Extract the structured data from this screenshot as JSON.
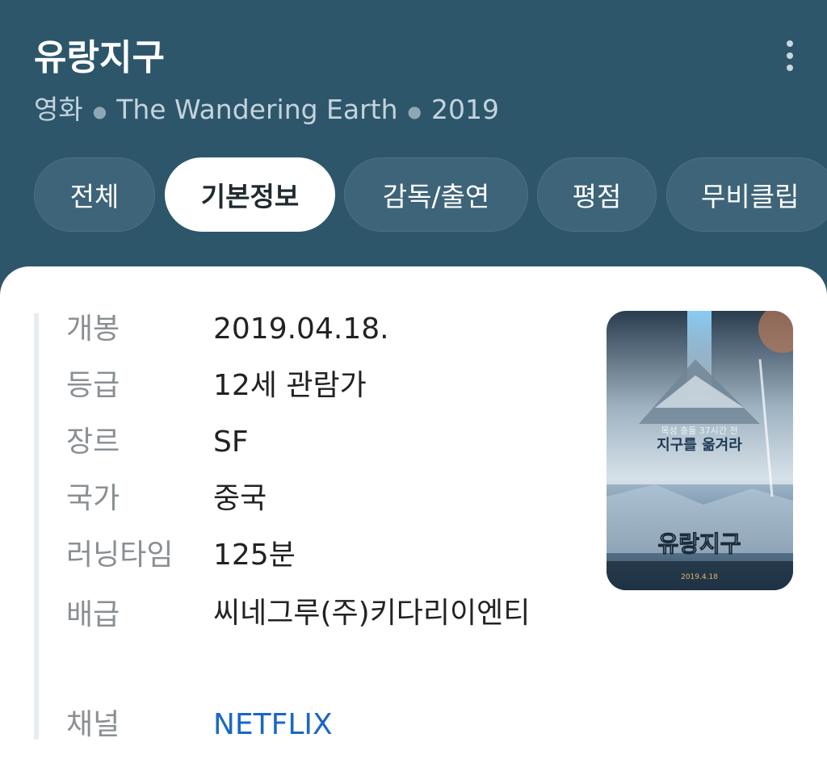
{
  "header": {
    "title": "유랑지구",
    "subtitle": {
      "category": "영화",
      "original_title": "The Wandering Earth",
      "year": "2019"
    },
    "more_icon": "more-vertical-icon"
  },
  "tabs": [
    {
      "label": "전체",
      "active": false
    },
    {
      "label": "기본정보",
      "active": true
    },
    {
      "label": "감독/출연",
      "active": false
    },
    {
      "label": "평점",
      "active": false
    },
    {
      "label": "무비클립",
      "active": false
    }
  ],
  "info": {
    "release": {
      "label": "개봉",
      "value": "2019.04.18."
    },
    "rating": {
      "label": "등급",
      "value": "12세 관람가"
    },
    "genre": {
      "label": "장르",
      "value": "SF"
    },
    "country": {
      "label": "국가",
      "value": "중국"
    },
    "runtime": {
      "label": "러닝타임",
      "value": "125분"
    },
    "distributor": {
      "label": "배급",
      "value": "씨네그루(주)키다리이엔티"
    },
    "channel": {
      "label": "채널",
      "value": "NETFLIX"
    }
  },
  "poster": {
    "tagline": "목성 충돌 37시간 전",
    "headline": "지구를 옮겨라",
    "title": "유랑지구",
    "date": "2019.4.18"
  },
  "colors": {
    "header_bg": "#2d566b",
    "link": "#1a67c5",
    "active_tab_bg": "#ffffff"
  }
}
